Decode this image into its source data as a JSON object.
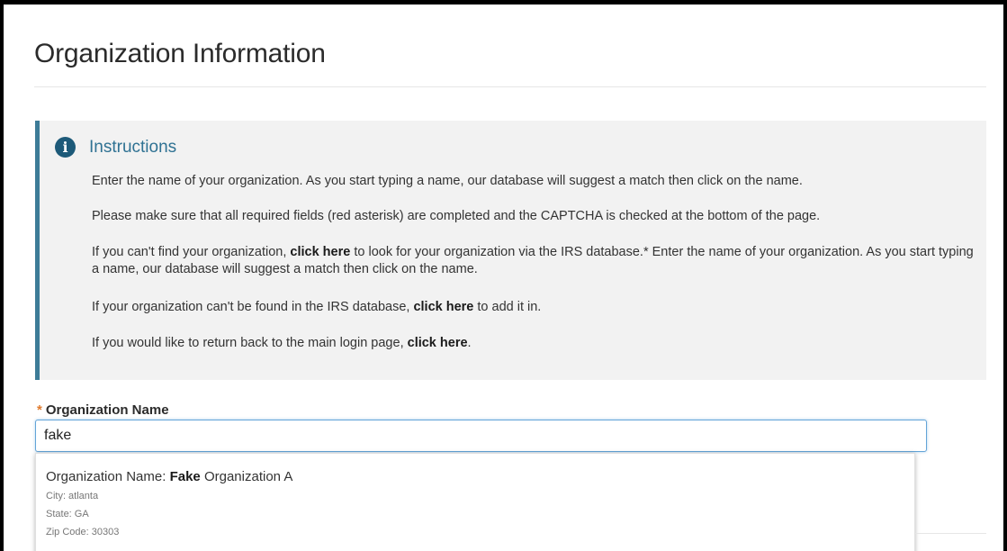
{
  "page": {
    "title": "Organization Information"
  },
  "instructions": {
    "icon": "info-icon",
    "heading": "Instructions",
    "p1": "Enter the name of your organization. As you start typing a name, our database will suggest a match then click on the name.",
    "p2": "Please make sure that all required fields (red asterisk) are completed and the CAPTCHA is checked at the bottom of the page.",
    "p3_before": "If you can't find your organization, ",
    "p3_link": "click here",
    "p3_after": " to look for your organization via the IRS database.* Enter the name of your organization. As you start typing a name, our database will suggest a match then click on the name.",
    "p4_before": "If your organization can't be found in the IRS database, ",
    "p4_link": "click here",
    "p4_after": " to add it in.",
    "p5_before": "If you would like to return back to the main login page, ",
    "p5_link": "click here",
    "p5_after": "."
  },
  "form": {
    "required_marker": "*",
    "org_label": "Organization Name",
    "org_value": "fake"
  },
  "suggestions": [
    {
      "name_label": "Organization Name: ",
      "name_match": "Fake",
      "name_rest": " Organization A",
      "city": "City: atlanta",
      "state": "State: GA",
      "zip": "Zip Code: 30303"
    }
  ],
  "colors": {
    "accent_border": "#3d7c98",
    "info_icon": "#1d5a79",
    "heading_blue": "#2f7293",
    "required_star": "#e07b2e",
    "input_focus": "#63a4d8"
  }
}
